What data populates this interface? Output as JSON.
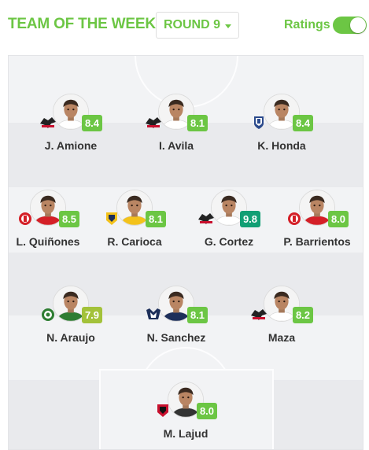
{
  "header": {
    "title": "TEAM OF THE WEEK",
    "round_label": "ROUND 9",
    "ratings_label": "Ratings",
    "ratings_on": true
  },
  "colors": {
    "accent": "#6cc644",
    "rating_good": "#6cc644",
    "rating_very_good": "#2ea84b",
    "rating_excellent": "#119f74",
    "rating_average": "#a3c23a"
  },
  "formation": [
    [
      {
        "name": "J. Amione",
        "rating": "8.4",
        "team_logo": "lobos-buap-logo",
        "shirt": "#ffffff",
        "rating_color": "#6cc644"
      },
      {
        "name": "I. Avila",
        "rating": "8.1",
        "team_logo": "lobos-buap-logo",
        "shirt": "#ffffff",
        "rating_color": "#6cc644"
      },
      {
        "name": "K. Honda",
        "rating": "8.4",
        "team_logo": "pachuca-logo",
        "shirt": "#ffffff",
        "rating_color": "#6cc644"
      }
    ],
    [
      {
        "name": "L. Quiñones",
        "rating": "8.5",
        "team_logo": "toluca-logo",
        "shirt": "#d41f27",
        "rating_color": "#6cc644"
      },
      {
        "name": "R. Carioca",
        "rating": "8.1",
        "team_logo": "tigres-logo",
        "shirt": "#f3c21b",
        "rating_color": "#6cc644"
      },
      {
        "name": "G. Cortez",
        "rating": "9.8",
        "team_logo": "lobos-buap-logo",
        "shirt": "#ffffff",
        "rating_color": "#119f74"
      },
      {
        "name": "P. Barrientos",
        "rating": "8.0",
        "team_logo": "toluca-logo",
        "shirt": "#d41f27",
        "rating_color": "#6cc644"
      }
    ],
    [
      {
        "name": "N. Araujo",
        "rating": "7.9",
        "team_logo": "santos-logo",
        "shirt": "#2e7d32",
        "rating_color": "#a3c23a"
      },
      {
        "name": "N. Sanchez",
        "rating": "8.1",
        "team_logo": "monterrey-logo",
        "shirt": "#1d2f5a",
        "rating_color": "#6cc644"
      },
      {
        "name": "Maza",
        "rating": "8.2",
        "team_logo": "lobos-buap-logo",
        "shirt": "#ffffff",
        "rating_color": "#6cc644"
      }
    ],
    [
      {
        "name": "M. Lajud",
        "rating": "8.0",
        "team_logo": "tijuana-logo",
        "shirt": "#333333",
        "rating_color": "#6cc644"
      }
    ]
  ]
}
